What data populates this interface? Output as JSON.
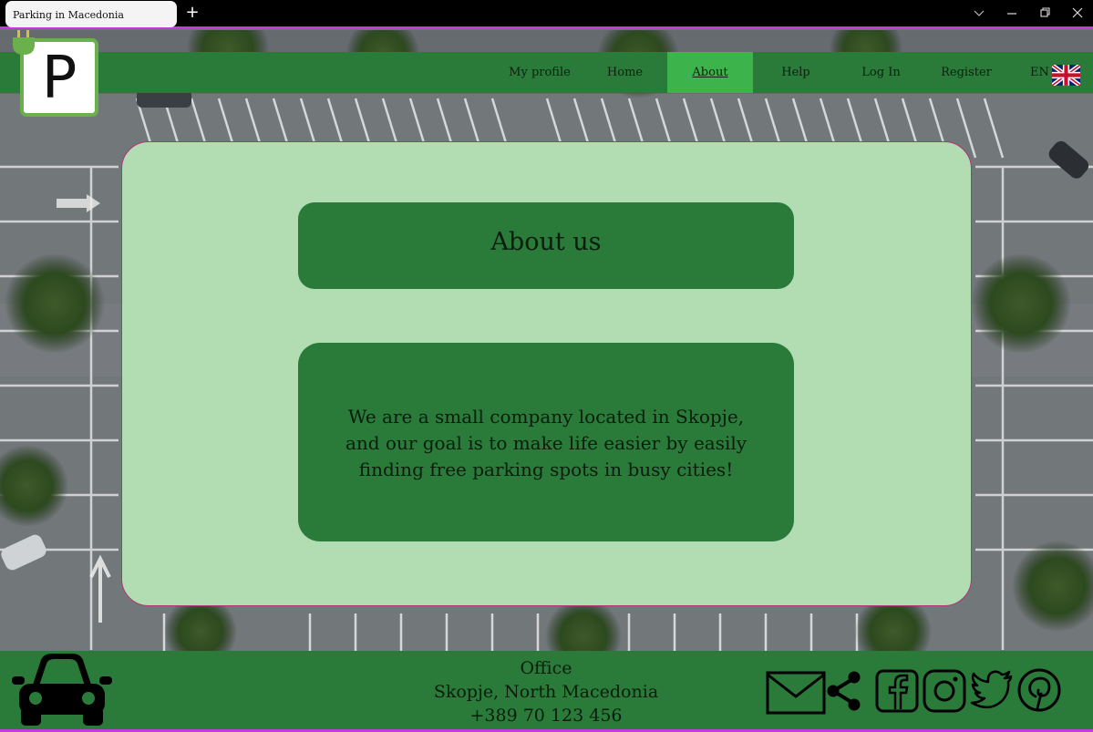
{
  "browser": {
    "tab_title": "Parking in Macedonia",
    "new_tab_icon": "plus-icon",
    "controls": [
      "chevron-down-icon",
      "minimize-icon",
      "restore-icon",
      "close-icon"
    ]
  },
  "brand": {
    "logo_letter": "P",
    "accent_green": "#2a7a3a",
    "active_green": "#3cb44b",
    "card_bg": "#b2dcb1",
    "card_border": "#b0347a"
  },
  "nav": {
    "items": [
      {
        "label": "My profile"
      },
      {
        "label": "Home"
      },
      {
        "label": "About",
        "active": true
      },
      {
        "label": "Help"
      },
      {
        "label": "Log In"
      },
      {
        "label": "Register"
      }
    ],
    "language": "EN",
    "language_icon": "uk-flag-icon"
  },
  "main": {
    "title": "About us",
    "body_lines": [
      "We are a small company located in Skopje,",
      "and our goal is to make life easier by easily",
      "finding free parking spots in busy cities!"
    ]
  },
  "footer": {
    "office_title": "Office",
    "address": "Skopje, North Macedonia",
    "phone": "+389 70 123 456",
    "icons": [
      "car-icon",
      "mail-icon",
      "share-icon",
      "facebook-icon",
      "instagram-icon",
      "twitter-icon",
      "pinterest-icon"
    ]
  }
}
